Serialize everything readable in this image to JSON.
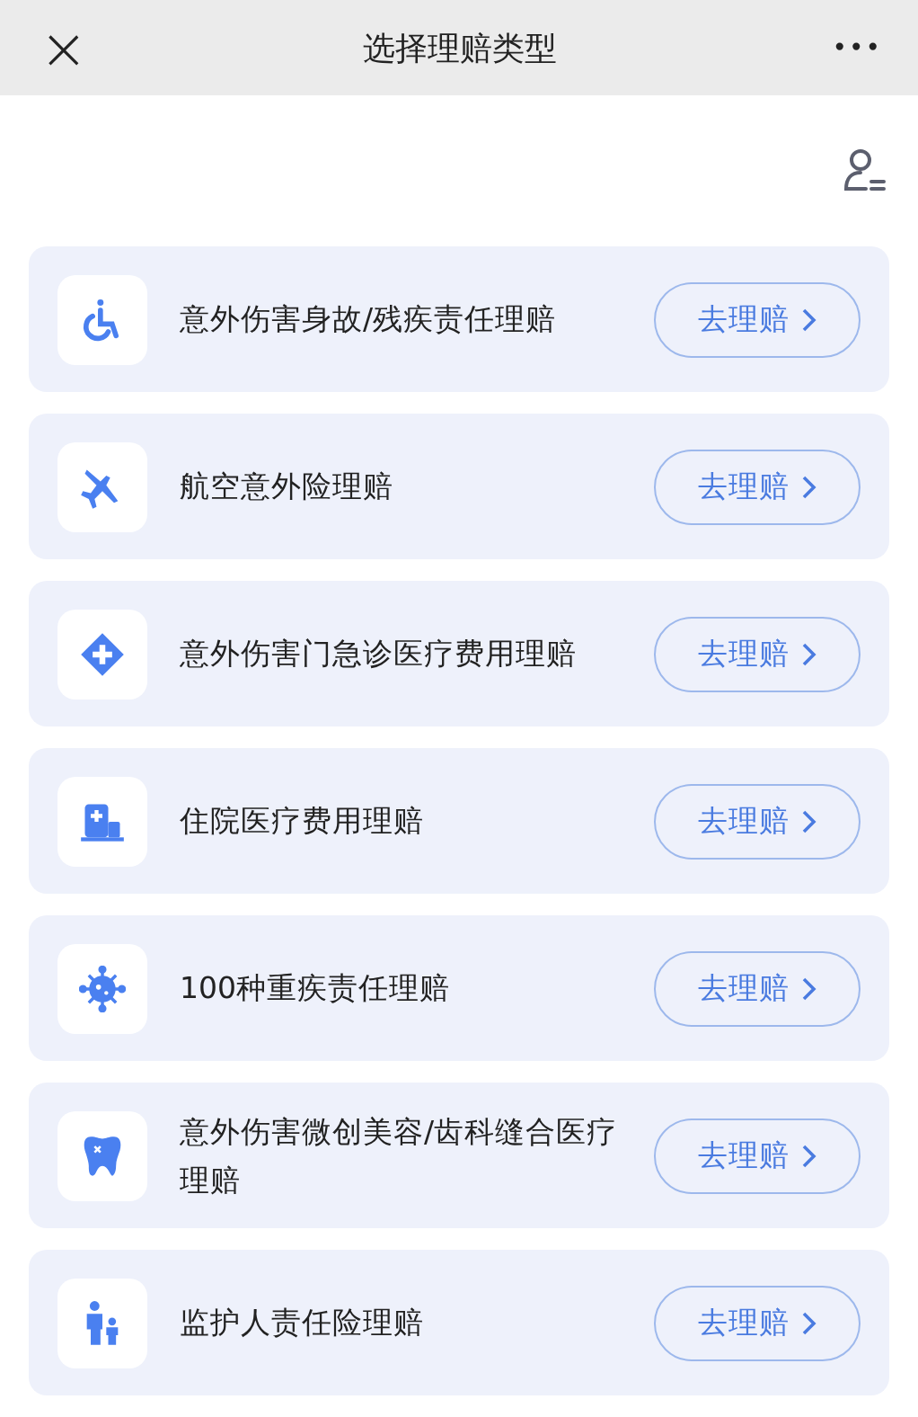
{
  "header": {
    "close": "×",
    "title": "选择理赔类型",
    "more": "•••"
  },
  "claims": [
    {
      "kind": "wheelchair",
      "label": "意外伤害身故/残疾责任理赔",
      "button": "去理赔"
    },
    {
      "kind": "plane",
      "label": "航空意外险理赔",
      "button": "去理赔"
    },
    {
      "kind": "medical",
      "label": "意外伤害门急诊医疗费用理赔",
      "button": "去理赔"
    },
    {
      "kind": "hospital",
      "label": "住院医疗费用理赔",
      "button": "去理赔"
    },
    {
      "kind": "virus",
      "label": "100种重疾责任理赔",
      "button": "去理赔"
    },
    {
      "kind": "tooth",
      "label": "意外伤害微创美容/齿科缝合医疗理赔",
      "button": "去理赔"
    },
    {
      "kind": "family",
      "label": "监护人责任险理赔",
      "button": "去理赔"
    }
  ]
}
